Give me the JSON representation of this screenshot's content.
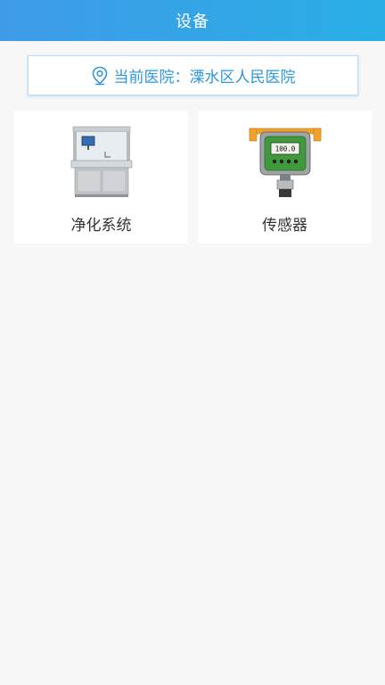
{
  "header": {
    "title": "设备"
  },
  "hospital": {
    "prefix": "当前医院：",
    "name": "溧水区人民医院",
    "icon": "location-pin-icon",
    "accent": "#2c97dd"
  },
  "devices": [
    {
      "label": "净化系统",
      "icon": "purification-station-image"
    },
    {
      "label": "传感器",
      "icon": "gas-sensor-image",
      "display_reading": "100.0"
    }
  ]
}
